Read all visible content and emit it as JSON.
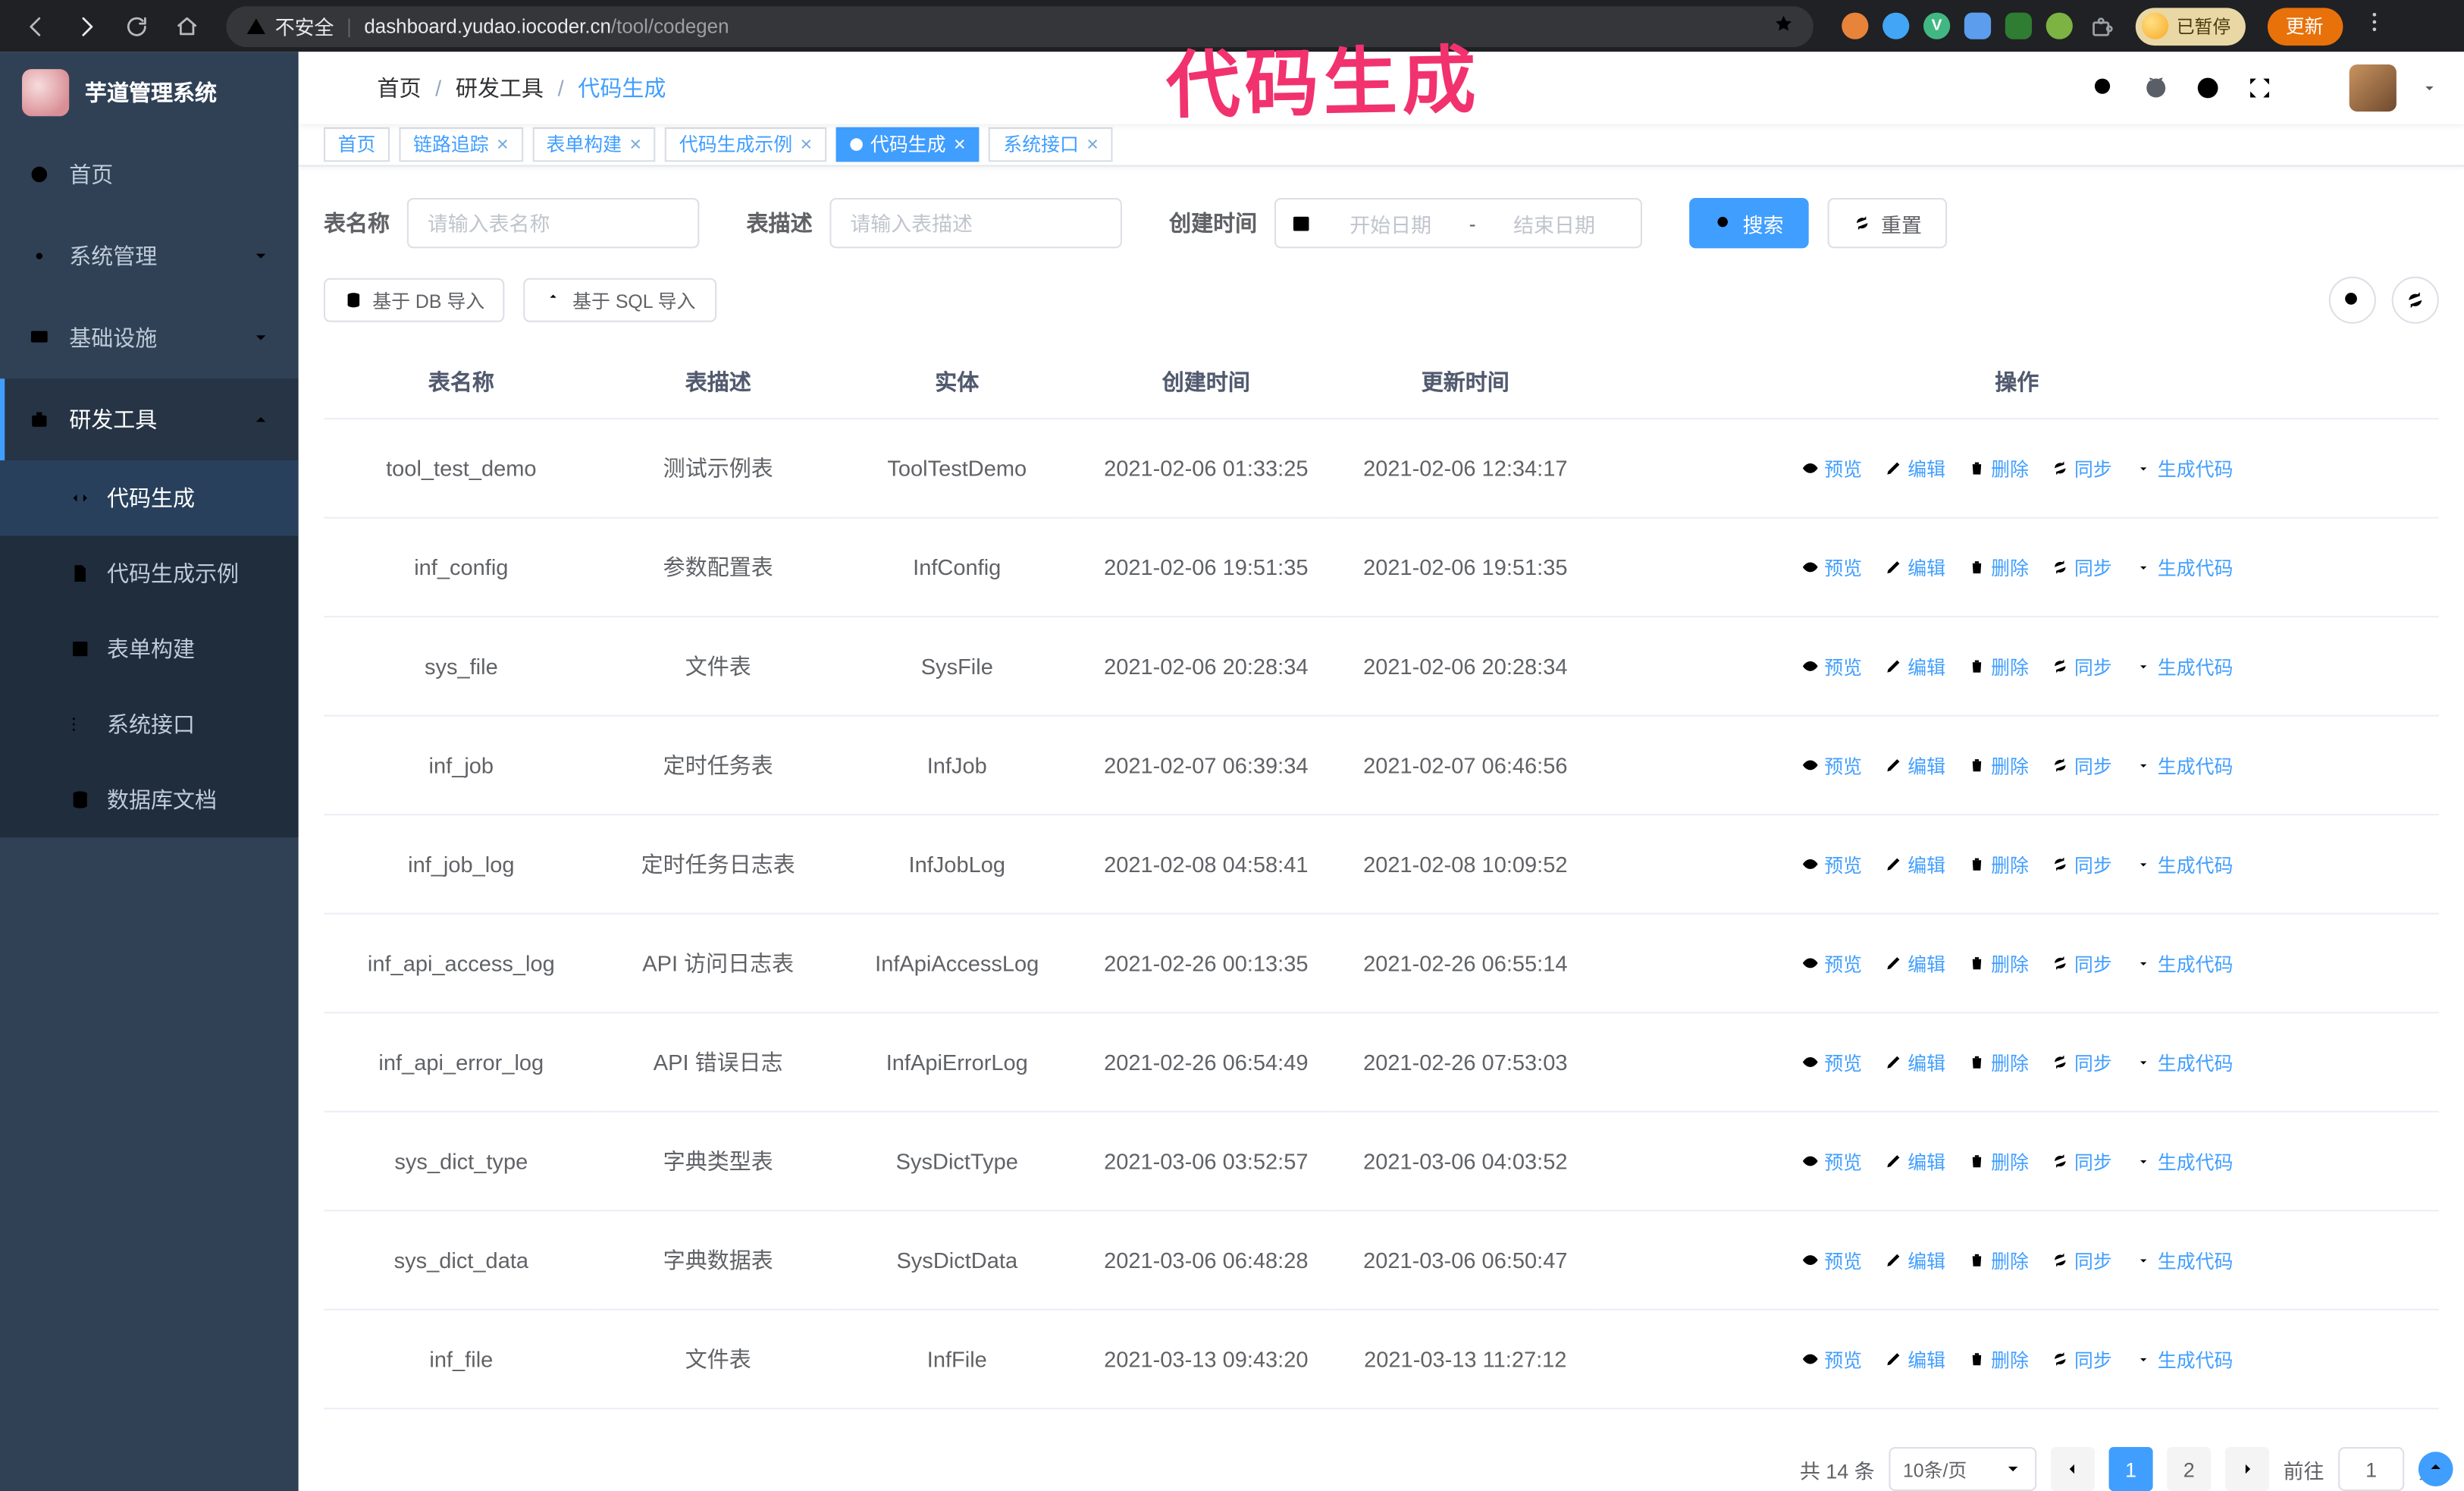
{
  "browser": {
    "security_label": "不安全",
    "url_host": "dashboard.yudao.iocoder.cn",
    "url_path": "/tool/codegen",
    "profile_badge": "已暂停",
    "update_button": "更新",
    "vue_devtools_letter": "V"
  },
  "annotation": {
    "text": "代码生成",
    "color": "#f1326e"
  },
  "sidebar": {
    "logo_title": "芋道管理系统",
    "items": [
      {
        "label": "首页",
        "icon": "gauge-icon"
      },
      {
        "label": "系统管理",
        "icon": "gear-icon",
        "chevron": "down"
      },
      {
        "label": "基础设施",
        "icon": "monitor-icon",
        "chevron": "down"
      },
      {
        "label": "研发工具",
        "icon": "toolbox-icon",
        "chevron": "up",
        "expanded": true
      }
    ],
    "subitems": [
      {
        "label": "代码生成",
        "icon": "code-icon",
        "active": true
      },
      {
        "label": "代码生成示例",
        "icon": "document-icon"
      },
      {
        "label": "表单构建",
        "icon": "form-icon"
      },
      {
        "label": "系统接口",
        "icon": "list-icon"
      },
      {
        "label": "数据库文档",
        "icon": "database-icon"
      }
    ]
  },
  "header": {
    "breadcrumb": [
      "首页",
      "研发工具",
      "代码生成"
    ]
  },
  "tabs": [
    {
      "label": "首页"
    },
    {
      "label": "链路追踪",
      "closable": true
    },
    {
      "label": "表单构建",
      "closable": true
    },
    {
      "label": "代码生成示例",
      "closable": true
    },
    {
      "label": "代码生成",
      "closable": true,
      "active": true
    },
    {
      "label": "系统接口",
      "closable": true
    }
  ],
  "filters": {
    "table_name_label": "表名称",
    "table_name_placeholder": "请输入表名称",
    "table_desc_label": "表描述",
    "table_desc_placeholder": "请输入表描述",
    "create_time_label": "创建时间",
    "start_date_placeholder": "开始日期",
    "range_separator": "-",
    "end_date_placeholder": "结束日期",
    "search_button": "搜索",
    "reset_button": "重置"
  },
  "toolbar": {
    "import_db_button": "基于 DB 导入",
    "import_sql_button": "基于 SQL 导入"
  },
  "table": {
    "columns": [
      "表名称",
      "表描述",
      "实体",
      "创建时间",
      "更新时间",
      "操作"
    ],
    "ops": {
      "preview": "预览",
      "edit": "编辑",
      "delete": "删除",
      "sync": "同步",
      "generate": "生成代码"
    },
    "rows": [
      {
        "name": "tool_test_demo",
        "desc": "测试示例表",
        "entity": "ToolTestDemo",
        "created": "2021-02-06 01:33:25",
        "updated": "2021-02-06 12:34:17"
      },
      {
        "name": "inf_config",
        "desc": "参数配置表",
        "entity": "InfConfig",
        "created": "2021-02-06 19:51:35",
        "updated": "2021-02-06 19:51:35"
      },
      {
        "name": "sys_file",
        "desc": "文件表",
        "entity": "SysFile",
        "created": "2021-02-06 20:28:34",
        "updated": "2021-02-06 20:28:34"
      },
      {
        "name": "inf_job",
        "desc": "定时任务表",
        "entity": "InfJob",
        "created": "2021-02-07 06:39:34",
        "updated": "2021-02-07 06:46:56"
      },
      {
        "name": "inf_job_log",
        "desc": "定时任务日志表",
        "entity": "InfJobLog",
        "created": "2021-02-08 04:58:41",
        "updated": "2021-02-08 10:09:52"
      },
      {
        "name": "inf_api_access_log",
        "desc": "API 访问日志表",
        "entity": "InfApiAccessLog",
        "created": "2021-02-26 00:13:35",
        "updated": "2021-02-26 06:55:14"
      },
      {
        "name": "inf_api_error_log",
        "desc": "API 错误日志",
        "entity": "InfApiErrorLog",
        "created": "2021-02-26 06:54:49",
        "updated": "2021-02-26 07:53:03"
      },
      {
        "name": "sys_dict_type",
        "desc": "字典类型表",
        "entity": "SysDictType",
        "created": "2021-03-06 03:52:57",
        "updated": "2021-03-06 04:03:52"
      },
      {
        "name": "sys_dict_data",
        "desc": "字典数据表",
        "entity": "SysDictData",
        "created": "2021-03-06 06:48:28",
        "updated": "2021-03-06 06:50:47"
      },
      {
        "name": "inf_file",
        "desc": "文件表",
        "entity": "InfFile",
        "created": "2021-03-13 09:43:20",
        "updated": "2021-03-13 11:27:12"
      }
    ]
  },
  "pagination": {
    "total_text": "共 14 条",
    "page_size": "10条/页",
    "pages": [
      "1",
      "2"
    ],
    "active_page": "1",
    "goto_prefix": "前往",
    "goto_value": "1",
    "goto_suffix": "页"
  },
  "colors": {
    "accent": "#409eff",
    "sidebar_bg": "#304156",
    "annotation": "#f1326e"
  }
}
